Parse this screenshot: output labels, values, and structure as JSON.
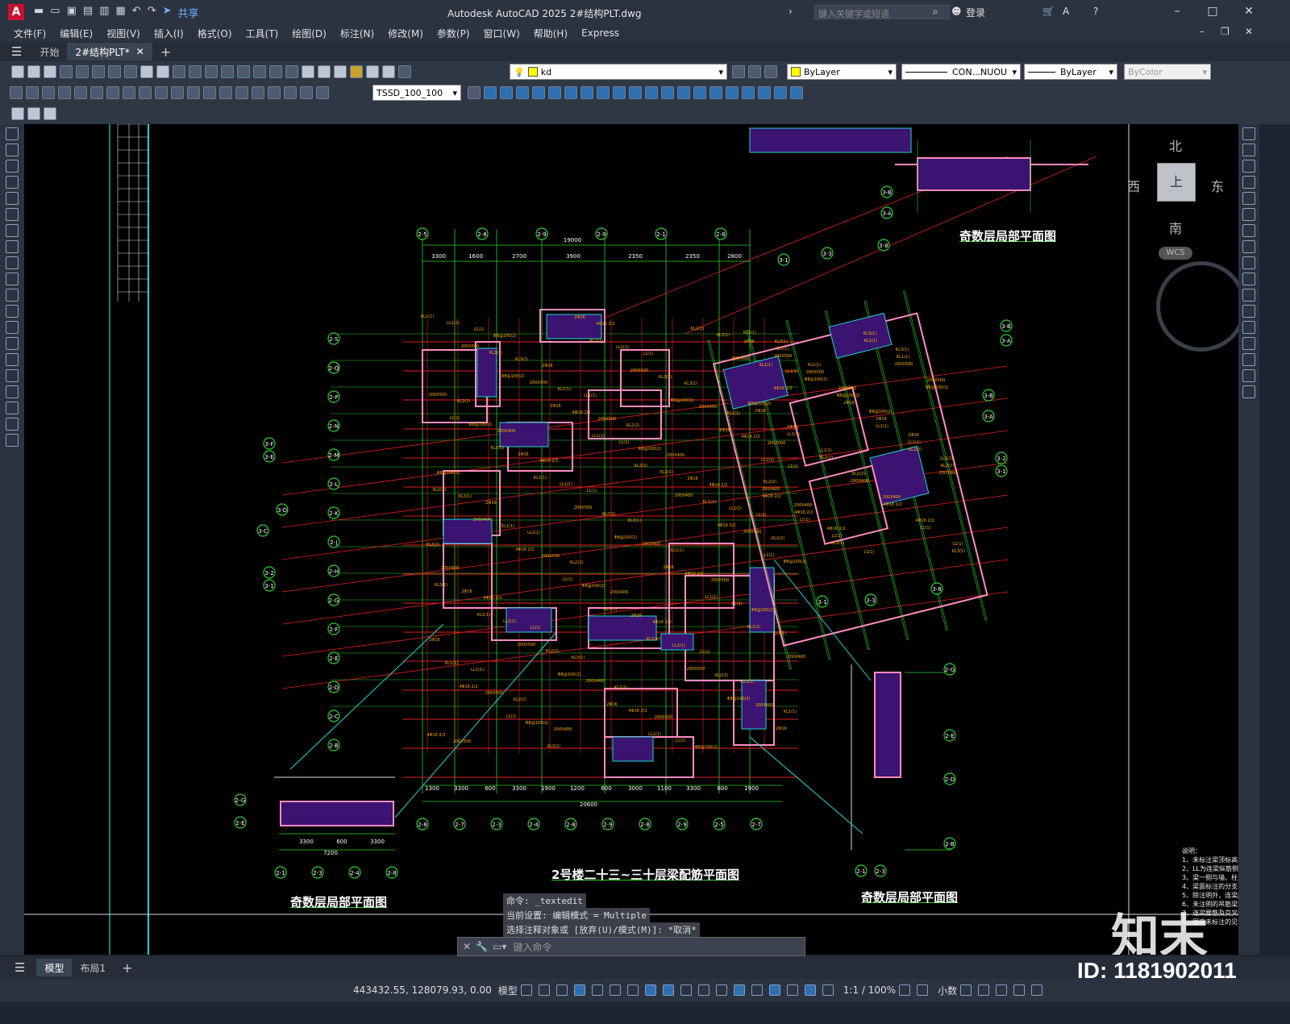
{
  "titlebar": {
    "app_logo": "A",
    "share_label": "共享",
    "title": "Autodesk AutoCAD 2025    2#结构PLT.dwg",
    "search_placeholder": "键入关键字或短语",
    "login_label": "登录"
  },
  "menubar": [
    "文件(F)",
    "编辑(E)",
    "视图(V)",
    "插入(I)",
    "格式(O)",
    "工具(T)",
    "绘图(D)",
    "标注(N)",
    "修改(M)",
    "参数(P)",
    "窗口(W)",
    "帮助(H)",
    "Express"
  ],
  "tabs": {
    "start": "开始",
    "active": "2#结构PLT*",
    "add": "+"
  },
  "toolbar": {
    "layer_value": "kd",
    "color_value": "ByLayer",
    "linetype_value": "CON...NUOU",
    "lineweight_value": "ByLayer",
    "plotstyle_value": "ByColor",
    "dimstyle_value": "TSSD_100_100"
  },
  "viewcube": {
    "north": "北",
    "south": "南",
    "east": "东",
    "west": "西",
    "top": "上",
    "wcs": "WCS"
  },
  "drawing": {
    "main_title": "2号楼二十三~三十层梁配筋平面图",
    "local_title_top": "奇数层局部平面图",
    "local_title_left": "奇数层局部平面图",
    "local_title_right": "奇数层局部平面图",
    "top_dims": [
      "3300",
      "1600",
      "2700",
      "3900",
      "2350",
      "2350",
      "2800"
    ],
    "top_total": "19000",
    "bottom_dims": [
      "1300",
      "3300",
      "600",
      "3300",
      "1900",
      "1200",
      "600",
      "3000",
      "1100",
      "3300",
      "600",
      "1900"
    ],
    "bottom_total": "20600",
    "axis_top": [
      "2-5",
      "2-8",
      "2-9",
      "2-9",
      "2-1",
      "2-8"
    ],
    "axis_bottom": [
      "2-8",
      "2-7",
      "2-3",
      "2-4",
      "2-8",
      "2-9",
      "2-8",
      "2-9",
      "2-5",
      "2-7"
    ],
    "axis_left": [
      "2-S",
      "2-Q",
      "2-P",
      "2-N",
      "2-M",
      "2-L",
      "2-K",
      "2-J",
      "2-H",
      "2-G",
      "2-F",
      "2-E",
      "2-D",
      "2-C",
      "2-B"
    ],
    "left_local_dims": [
      "3300",
      "600",
      "3300"
    ],
    "left_local_total": "7200",
    "left_local_axes": [
      "2-1",
      "2-3",
      "2-4",
      "2-8"
    ],
    "notes_title": "说明：",
    "notes": [
      "1、未标注梁顶标高为同，其他未标注",
      "2、LL为连梁纵筋侧面",
      "3、梁一侧与墙、柱走齐，一侧与墙",
      "4、梁面标注的分支，况影相交处",
      "5、除注明外，连梁腰筋详墙身水平",
      "6、未注明的吊筋梁端腰筋做法(0",
      "7、连梁腰筋及交叉暗撑详设计总说",
      "8、图中未标注的见告"
    ]
  },
  "commandline": {
    "line1": "命令: _textedit",
    "line2": "当前设置: 编辑模式 = Multiple",
    "line3": "选择注释对象或 [放弃(U)/模式(M)]: *取消*",
    "input_placeholder": "键入命令"
  },
  "layout_tabs": {
    "model": "模型",
    "layout1": "布局1",
    "add": "+"
  },
  "statusbar": {
    "coords": "443432.55, 128079.93, 0.00",
    "mode": "模型",
    "scale": "1:1 / 100%",
    "units": "小数"
  },
  "watermark": {
    "brand": "知末",
    "id": "ID: 1181902011"
  }
}
